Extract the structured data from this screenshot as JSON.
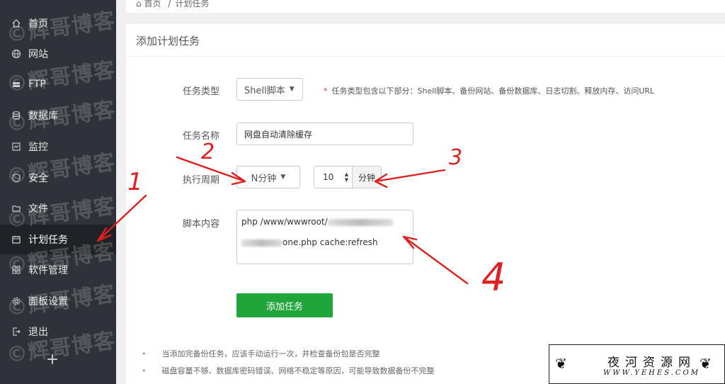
{
  "sidebar": {
    "items": [
      {
        "label": "首页",
        "icon": "home-icon"
      },
      {
        "label": "网站",
        "icon": "globe-icon"
      },
      {
        "label": "FTP",
        "icon": "ftp-icon"
      },
      {
        "label": "数据库",
        "icon": "database-icon"
      },
      {
        "label": "监控",
        "icon": "monitor-icon"
      },
      {
        "label": "安全",
        "icon": "shield-icon"
      },
      {
        "label": "文件",
        "icon": "folder-icon"
      },
      {
        "label": "计划任务",
        "icon": "calendar-icon",
        "active": true
      },
      {
        "label": "软件管理",
        "icon": "grid-icon"
      },
      {
        "label": "面板设置",
        "icon": "gear-icon"
      },
      {
        "label": "退出",
        "icon": "logout-icon"
      }
    ],
    "add_label": "+",
    "watermark": "©辉哥博客"
  },
  "breadcrumb": {
    "home": "首页",
    "sep": "/",
    "current": "计划任务"
  },
  "panel": {
    "title": "添加计划任务",
    "task_type": {
      "label": "任务类型",
      "value": "Shell脚本",
      "hint": "任务类型包含以下部分：Shell脚本、备份网站、备份数据库、日志切割、释放内存、访问URL"
    },
    "task_name": {
      "label": "任务名称",
      "value": "网盘自动清除缓存"
    },
    "period": {
      "label": "执行周期",
      "value": "N分钟",
      "number": "10",
      "unit": "分钟"
    },
    "script": {
      "label": "脚本内容",
      "line1": "php /www/wwwroot/",
      "line2": "one.php cache:refresh"
    },
    "submit_label": "添加任务"
  },
  "notes": [
    "当添加完备份任务，应该手动运行一次，并检查备份包是否完整",
    "磁盘容量不够、数据库密码错误、网络不稳定等原因，可能导致数据备份不完整"
  ],
  "annotations": {
    "a1": "1",
    "a2": "2",
    "a3": "3",
    "a4": "4"
  },
  "logo": {
    "cn": "夜河资源网",
    "en": "WWW.YEHES.COM"
  },
  "colors": {
    "sidebar_bg": "#2f3339",
    "accent_green": "#20a53a",
    "annotation_red": "#e02020"
  }
}
